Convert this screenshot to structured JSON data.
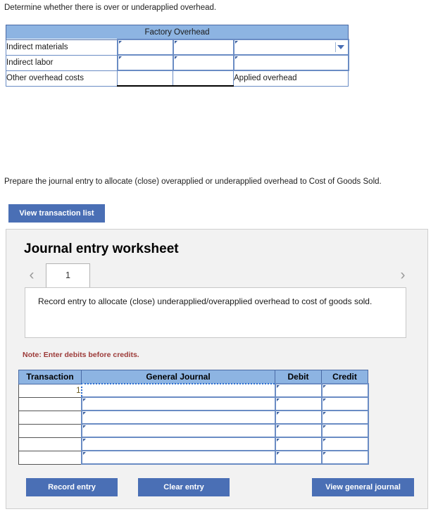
{
  "instructions": {
    "top": "Determine whether there is over or underapplied overhead.",
    "middle": "Prepare the journal entry to allocate (close) overapplied or underapplied overhead to Cost of Goods Sold."
  },
  "factory_overhead": {
    "title": "Factory Overhead",
    "rows": [
      {
        "label": "Indirect materials",
        "col1": "",
        "col2": "",
        "col3": "",
        "has_dropdown": true
      },
      {
        "label": "Indirect labor",
        "col1": "",
        "col2": "",
        "col3": "",
        "has_dropdown": false
      },
      {
        "label": "Other overhead costs",
        "col1": "",
        "col2": "",
        "col3": "Applied overhead",
        "has_dropdown": false
      }
    ]
  },
  "view_transaction_button": "View transaction list",
  "worksheet": {
    "title": "Journal entry worksheet",
    "prev_arrow": "‹",
    "next_arrow": "›",
    "tabs": [
      {
        "label": "1",
        "active": true
      }
    ],
    "description": "Record entry to allocate (close) underapplied/overapplied overhead to cost of goods sold.",
    "note": "Note: Enter debits before credits.",
    "table": {
      "headers": [
        "Transaction",
        "General Journal",
        "Debit",
        "Credit"
      ],
      "rows": [
        {
          "transaction": "1",
          "general_journal": "",
          "debit": "",
          "credit": "",
          "selected": true
        },
        {
          "transaction": "",
          "general_journal": "",
          "debit": "",
          "credit": "",
          "selected": false
        },
        {
          "transaction": "",
          "general_journal": "",
          "debit": "",
          "credit": "",
          "selected": false
        },
        {
          "transaction": "",
          "general_journal": "",
          "debit": "",
          "credit": "",
          "selected": false
        },
        {
          "transaction": "",
          "general_journal": "",
          "debit": "",
          "credit": "",
          "selected": false
        },
        {
          "transaction": "",
          "general_journal": "",
          "debit": "",
          "credit": "",
          "selected": false
        }
      ]
    },
    "buttons": {
      "record": "Record entry",
      "clear": "Clear entry",
      "view_general_journal": "View general journal"
    }
  },
  "colors": {
    "header_blue": "#8db4e2",
    "button_blue": "#4a6fb5",
    "cell_border_blue": "#6a8cc4",
    "note_red": "#9c3a38",
    "panel_gray": "#f2f2f2"
  }
}
